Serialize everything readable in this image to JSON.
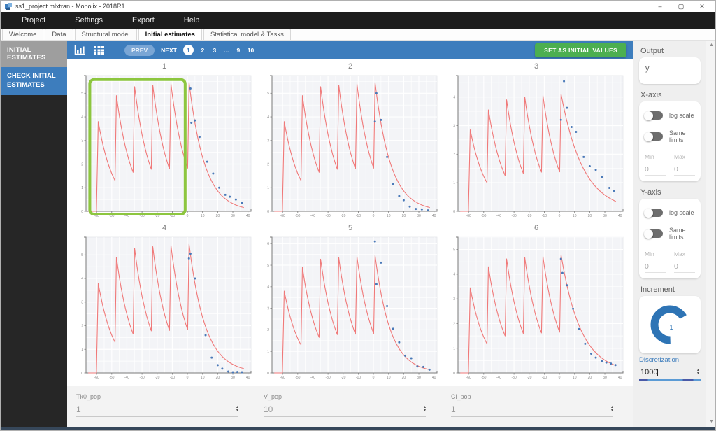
{
  "window": {
    "title": "ss1_project.mlxtran - Monolix - 2018R1",
    "minimize": "–",
    "maximize": "▢",
    "close": "✕"
  },
  "menu": {
    "items": [
      "Project",
      "Settings",
      "Export",
      "Help"
    ]
  },
  "tabs": {
    "items": [
      "Welcome",
      "Data",
      "Structural model",
      "Initial estimates",
      "Statistical model & Tasks"
    ],
    "active": "Initial estimates"
  },
  "sidebar": {
    "header": "INITIAL ESTIMATES",
    "items": [
      {
        "label": "CHECK INITIAL ESTIMATES",
        "active": true
      }
    ]
  },
  "toolbar": {
    "icons": [
      "bar-chart-icon",
      "grid-icon"
    ],
    "prev_label": "PREV",
    "next_label": "NEXT",
    "pages": [
      "1",
      "2",
      "3",
      "...",
      "9",
      "10"
    ],
    "active_page": "1",
    "set_button": "SET AS INITIAL VALUES"
  },
  "right_panel": {
    "output": {
      "label": "Output",
      "value": "y"
    },
    "x_axis": {
      "label": "X-axis",
      "toggles": [
        {
          "label": "log scale",
          "on": false
        },
        {
          "label": "Same limits",
          "on": false
        }
      ],
      "min_label": "Min",
      "max_label": "Max",
      "min": "0",
      "max": "0"
    },
    "y_axis": {
      "label": "Y-axis",
      "toggles": [
        {
          "label": "log scale",
          "on": false
        },
        {
          "label": "Same limits",
          "on": false
        }
      ],
      "min_label": "Min",
      "max_label": "Max",
      "min": "0",
      "max": "0"
    },
    "increment": {
      "label": "Increment",
      "value": "1"
    },
    "discretization": {
      "label": "Discretization",
      "value": "1000"
    }
  },
  "params": [
    {
      "label": "Tk0_pop",
      "value": "1"
    },
    {
      "label": "V_pop",
      "value": "10"
    },
    {
      "label": "Cl_pop",
      "value": "1"
    }
  ],
  "colors": {
    "accent_blue": "#3d7dbd",
    "green_button": "#4caf50",
    "highlight_green": "#8dc63f",
    "curve_red": "#f07878",
    "dot_blue": "#4a79b8",
    "plot_bg": "#f3f4f7",
    "axis_gray": "#7a7a7a",
    "sidebar_dark": "#262626",
    "header_gray": "#9e9e9e",
    "panel_gray": "#efefef",
    "footer_navy": "#36475a",
    "gauge_blue": "#2e74b5"
  },
  "chart_data": {
    "type": "line",
    "layout": {
      "rows": 2,
      "cols": 3
    },
    "xlabel": "",
    "ylabel": "",
    "grid": true,
    "xlim": [
      -67,
      42
    ],
    "x_ticks": [
      -60,
      -50,
      -40,
      -30,
      -20,
      -10,
      0,
      10,
      20,
      30,
      40
    ],
    "dose_times": [
      -60,
      -48,
      -36,
      -24,
      -12,
      0
    ],
    "rise_duration": 1.1,
    "subplots": [
      {
        "title": "1",
        "ylim": [
          0,
          5.75
        ],
        "y_ticks": [
          0,
          1,
          2,
          3,
          4,
          5
        ],
        "peaks": [
          3.8,
          4.9,
          5.28,
          5.35,
          5.4,
          5.45
        ],
        "troughs": [
          1.3,
          1.65,
          1.78,
          1.8,
          1.83
        ],
        "decay_end": 0.15,
        "dots": [
          [
            2,
            5.2
          ],
          [
            2.6,
            3.75
          ],
          [
            5,
            3.85
          ],
          [
            8,
            3.15
          ],
          [
            13,
            2.1
          ],
          [
            17,
            1.6
          ],
          [
            21,
            1.0
          ],
          [
            25,
            0.7
          ],
          [
            28,
            0.62
          ],
          [
            32,
            0.5
          ],
          [
            36,
            0.35
          ]
        ],
        "highlight": {
          "x0": -64.5,
          "x1": -1.5,
          "y0": -0.12,
          "y1": 5.58
        }
      },
      {
        "title": "2",
        "ylim": [
          0,
          5.75
        ],
        "y_ticks": [
          0,
          1,
          2,
          3,
          4,
          5
        ],
        "peaks": [
          3.8,
          4.9,
          5.28,
          5.35,
          5.4,
          5.45
        ],
        "troughs": [
          1.3,
          1.65,
          1.78,
          1.8,
          1.83
        ],
        "decay_end": 0.15,
        "dots": [
          [
            1,
            3.8
          ],
          [
            2,
            5.0
          ],
          [
            5,
            3.87
          ],
          [
            9,
            2.3
          ],
          [
            13,
            1.15
          ],
          [
            17,
            0.65
          ],
          [
            20,
            0.47
          ],
          [
            24,
            0.2
          ],
          [
            28,
            0.1
          ],
          [
            32,
            0.08
          ],
          [
            36,
            0.04
          ]
        ]
      },
      {
        "title": "3",
        "ylim": [
          0,
          4.75
        ],
        "y_ticks": [
          0,
          1,
          2,
          3,
          4
        ],
        "peaks": [
          2.85,
          3.55,
          3.9,
          4.0,
          4.05,
          4.1
        ],
        "troughs": [
          1.0,
          1.25,
          1.33,
          1.37,
          1.38
        ],
        "decay_end": 0.33,
        "dots": [
          [
            1,
            3.2
          ],
          [
            3,
            4.55
          ],
          [
            5,
            3.62
          ],
          [
            8,
            2.95
          ],
          [
            11,
            2.78
          ],
          [
            16,
            1.9
          ],
          [
            20,
            1.58
          ],
          [
            24,
            1.45
          ],
          [
            28,
            1.2
          ],
          [
            33,
            0.82
          ],
          [
            36,
            0.72
          ]
        ]
      },
      {
        "title": "4",
        "ylim": [
          0,
          5.75
        ],
        "y_ticks": [
          0,
          1,
          2,
          3,
          4,
          5
        ],
        "peaks": [
          3.8,
          4.9,
          5.28,
          5.35,
          5.4,
          5.45
        ],
        "troughs": [
          1.3,
          1.65,
          1.78,
          1.8,
          1.83
        ],
        "decay_end": 0.17,
        "dots": [
          [
            1,
            4.85
          ],
          [
            2,
            5.05
          ],
          [
            5,
            4.0
          ],
          [
            12,
            1.6
          ],
          [
            16,
            0.65
          ],
          [
            20,
            0.33
          ],
          [
            23,
            0.18
          ],
          [
            27,
            0.06
          ],
          [
            30,
            0.03
          ],
          [
            33,
            0.04
          ],
          [
            36,
            0.03
          ]
        ]
      },
      {
        "title": "5",
        "ylim": [
          0,
          6.3
        ],
        "y_ticks": [
          0,
          1,
          2,
          3,
          4,
          5,
          6
        ],
        "peaks": [
          3.8,
          4.9,
          5.28,
          5.35,
          5.4,
          5.45
        ],
        "troughs": [
          1.3,
          1.65,
          1.78,
          1.8,
          1.83
        ],
        "decay_end": 0.14,
        "dots": [
          [
            1,
            6.1
          ],
          [
            2,
            4.12
          ],
          [
            5,
            5.12
          ],
          [
            9,
            3.1
          ],
          [
            13,
            2.05
          ],
          [
            17,
            1.42
          ],
          [
            21,
            0.8
          ],
          [
            25,
            0.68
          ],
          [
            29,
            0.3
          ],
          [
            33,
            0.28
          ],
          [
            37,
            0.15
          ]
        ]
      },
      {
        "title": "6",
        "ylim": [
          0,
          5.5
        ],
        "y_ticks": [
          0,
          1,
          2,
          3,
          4,
          5
        ],
        "peaks": [
          3.45,
          4.3,
          4.62,
          4.68,
          4.72,
          4.78
        ],
        "troughs": [
          1.18,
          1.5,
          1.6,
          1.62,
          1.65
        ],
        "decay_end": 0.28,
        "dots": [
          [
            1,
            4.62
          ],
          [
            2,
            4.05
          ],
          [
            5,
            3.55
          ],
          [
            9,
            2.6
          ],
          [
            13,
            1.78
          ],
          [
            17,
            1.18
          ],
          [
            21,
            0.78
          ],
          [
            24,
            0.62
          ],
          [
            28,
            0.48
          ],
          [
            31,
            0.42
          ],
          [
            34,
            0.38
          ],
          [
            37,
            0.32
          ]
        ]
      }
    ]
  }
}
